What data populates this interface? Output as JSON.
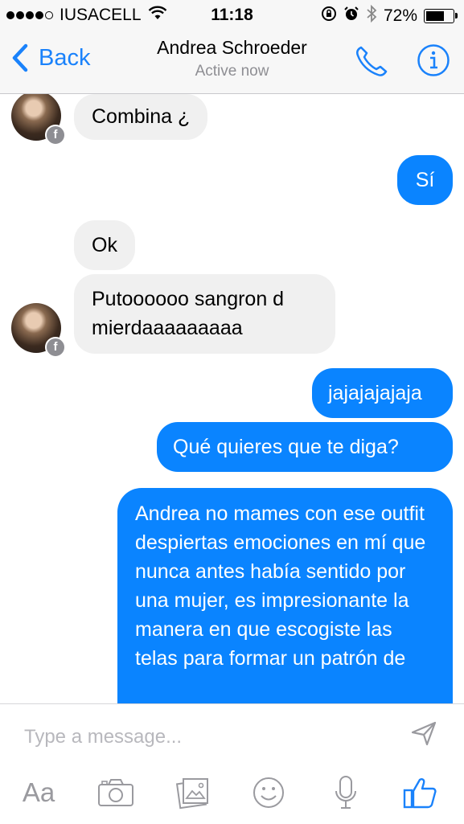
{
  "status_bar": {
    "carrier": "IUSACELL",
    "time": "11:18",
    "battery": "72%",
    "battery_level": 0.72,
    "signal_bars": 4
  },
  "header": {
    "back_label": "Back",
    "contact_name": "Andrea Schroeder",
    "presence": "Active now"
  },
  "messages": [
    {
      "from": "Andrea Schroeder",
      "text": "Combina ¿"
    },
    {
      "from": "me",
      "text": "Sí"
    },
    {
      "from": "Andrea Schroeder",
      "text": "Ok"
    },
    {
      "from": "Andrea Schroeder",
      "text": "Putoooooo sangron d mierdaaaaaaaaa"
    },
    {
      "from": "me",
      "text": "jajajajajaja"
    },
    {
      "from": "me",
      "text": "Qué quieres que te diga?"
    },
    {
      "from": "me",
      "text": "Andrea no mames con ese outfit despiertas emociones en mí que nunca antes había sentido por una mujer, es impresionante la manera en que escogiste las telas para formar un patrón de"
    }
  ],
  "composer": {
    "placeholder": "Type a message...",
    "aa_label": "Aa"
  },
  "colors": {
    "accent": "#1a82fb",
    "outgoing_bubble": "#0a84ff",
    "incoming_bubble": "#f0f0f0",
    "bar_background": "#f7f7f7",
    "icon_gray": "#9a9a9f"
  },
  "icons": [
    "wifi-icon",
    "lock-rotation-icon",
    "alarm-icon",
    "bluetooth-icon",
    "battery-icon",
    "back-chevron-icon",
    "phone-icon",
    "info-icon",
    "facebook-badge-icon",
    "send-icon",
    "camera-icon",
    "photo-gallery-icon",
    "emoji-icon",
    "microphone-icon",
    "like-thumb-icon"
  ]
}
